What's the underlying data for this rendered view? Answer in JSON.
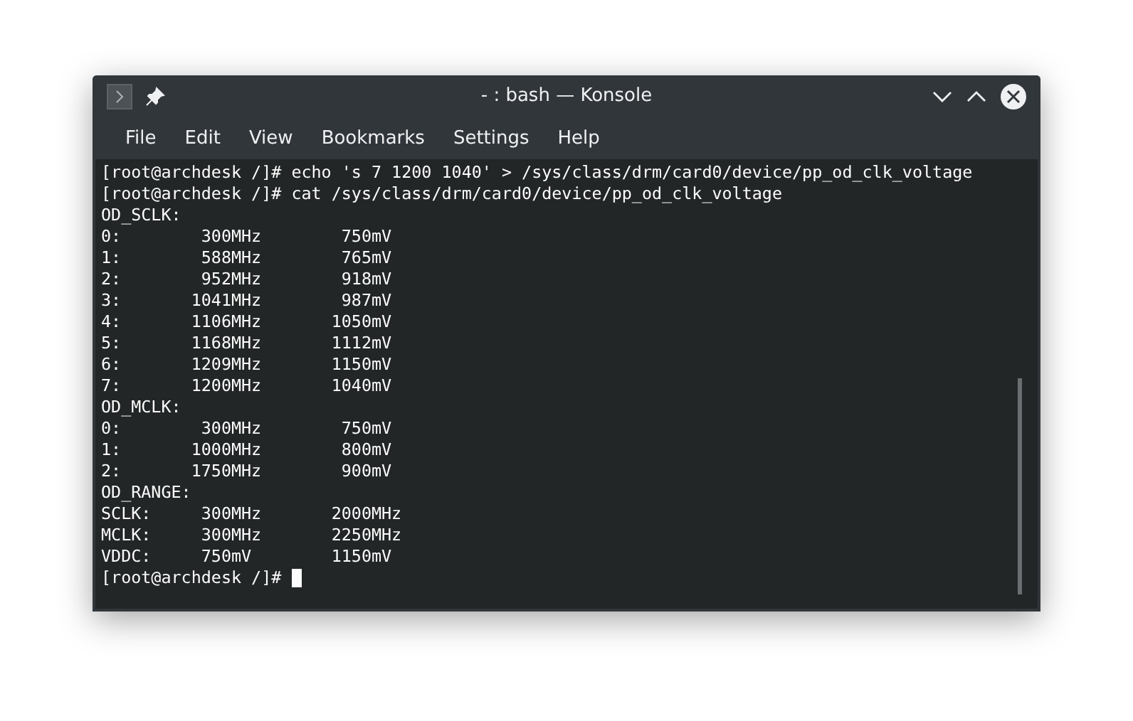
{
  "window": {
    "title": "- : bash — Konsole"
  },
  "menu": [
    "File",
    "Edit",
    "View",
    "Bookmarks",
    "Settings",
    "Help"
  ],
  "terminal": {
    "lines": [
      "[root@archdesk /]# echo 's 7 1200 1040' > /sys/class/drm/card0/device/pp_od_clk_voltage",
      "[root@archdesk /]# cat /sys/class/drm/card0/device/pp_od_clk_voltage",
      "OD_SCLK:",
      "0:        300MHz        750mV",
      "1:        588MHz        765mV",
      "2:        952MHz        918mV",
      "3:       1041MHz        987mV",
      "4:       1106MHz       1050mV",
      "5:       1168MHz       1112mV",
      "6:       1209MHz       1150mV",
      "7:       1200MHz       1040mV",
      "OD_MCLK:",
      "0:        300MHz        750mV",
      "1:       1000MHz        800mV",
      "2:       1750MHz        900mV",
      "OD_RANGE:",
      "SCLK:     300MHz       2000MHz",
      "MCLK:     300MHz       2250MHz",
      "VDDC:     750mV        1150mV",
      "[root@archdesk /]# "
    ]
  }
}
